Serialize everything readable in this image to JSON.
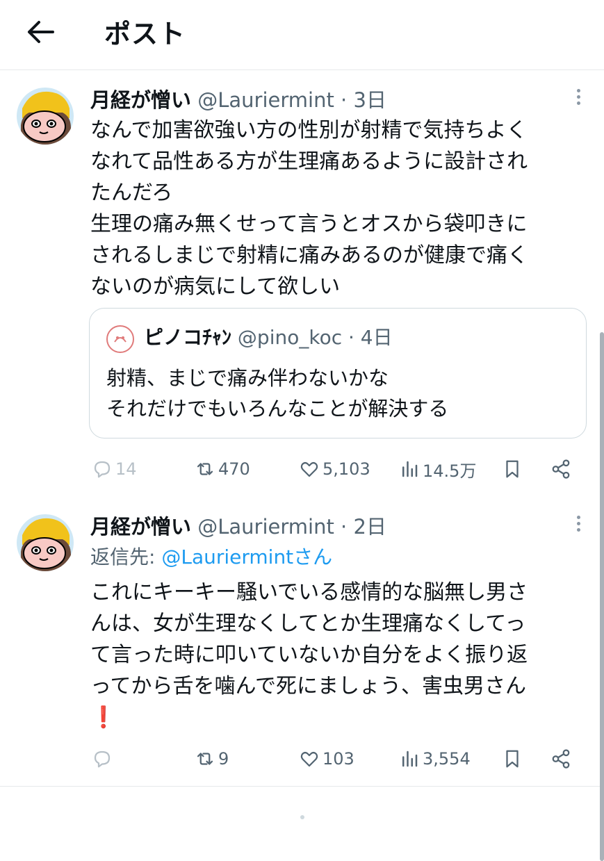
{
  "header": {
    "title": "ポスト"
  },
  "post1": {
    "display_name": "月経が憎い",
    "handle": "@Lauriermint",
    "separator": " · ",
    "time": "3日",
    "text": "なんで加害欲強い方の性別が射精で気持ちよく\nなれて品性ある方が生理痛あるように設計され\nたんだろ\n生理の痛み無くせって言うとオスから袋叩きに\nされるしまじで射精に痛みあるのが健康で痛く\nないのが病気にして欲しい",
    "quote": {
      "display_name": "ピノコﾁｬﾝ",
      "handle": "@pino_koc",
      "separator": " · ",
      "time": "4日",
      "text": "射精、まじで痛み伴わないかな\nそれだけでもいろんなことが解決する"
    },
    "actions": {
      "replies": "14",
      "reposts": "470",
      "likes": "5,103",
      "views": "14.5万"
    }
  },
  "post2": {
    "display_name": "月経が憎い",
    "handle": "@Lauriermint",
    "separator": " · ",
    "time": "2日",
    "reply_prefix": "返信先: ",
    "reply_target": "@Lauriermintさん",
    "text": "これにキーキー騒いでいる感情的な脳無し男さ\nんは、女が生理なくしてとか生理痛なくしてっ\nて言った時に叩いていないか自分をよく振り返\nってから舌を噛んで死にましょう、害虫男さん",
    "emoji": "❗",
    "actions": {
      "replies": "",
      "reposts": "9",
      "likes": "103",
      "views": "3,554"
    }
  },
  "colors": {
    "link": "#1d9bf0",
    "muted": "#536471",
    "text": "#0f1419",
    "emoji_red": "#e0245e"
  }
}
